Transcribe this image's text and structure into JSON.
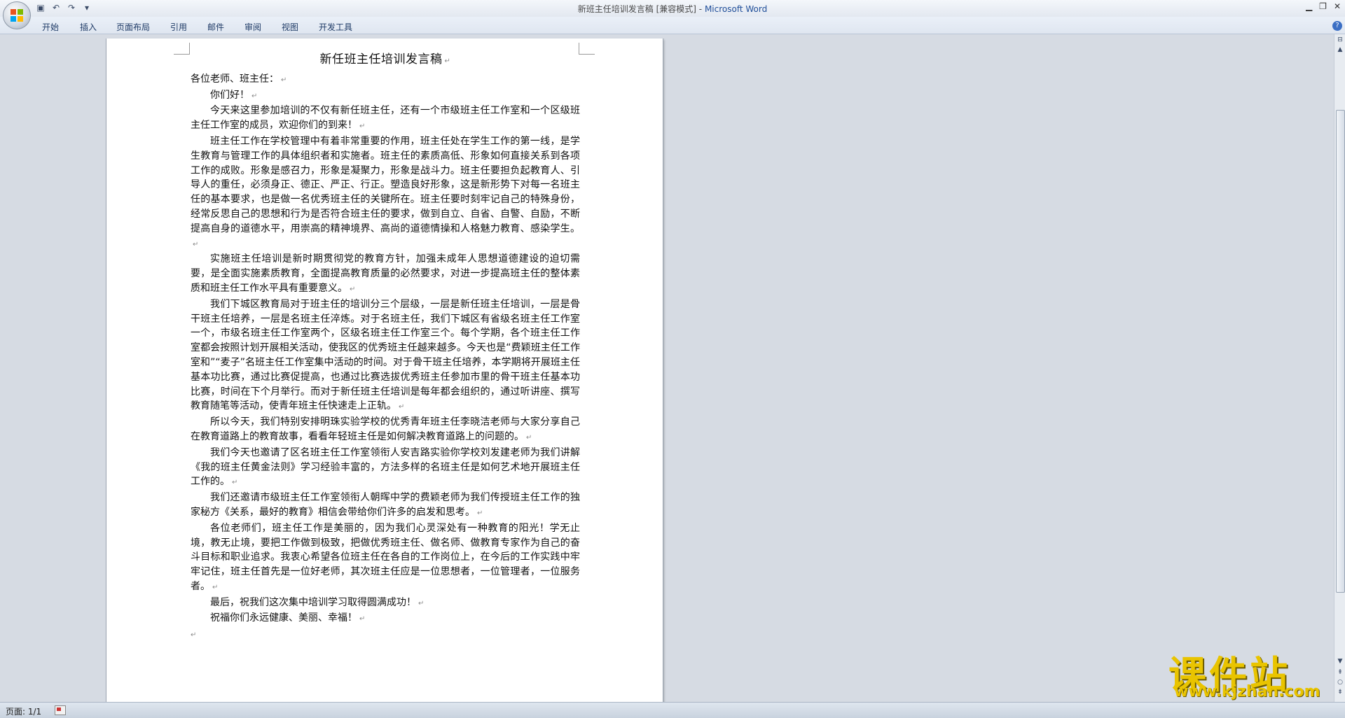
{
  "titlebar": {
    "doc_title": "新班主任培训发言稿 [兼容模式]",
    "separator": " - ",
    "app_name": "Microsoft Word"
  },
  "qat": {
    "save_icon": "save-icon",
    "undo_icon": "undo-icon",
    "redo_icon": "redo-icon",
    "more_icon": "dropdown-icon"
  },
  "tabs": [
    "开始",
    "插入",
    "页面布局",
    "引用",
    "邮件",
    "审阅",
    "视图",
    "开发工具"
  ],
  "document": {
    "title": "新任班主任培训发言稿",
    "paragraphs": [
      "各位老师、班主任：",
      "你们好！",
      "今天来这里参加培训的不仅有新任班主任，还有一个市级班主任工作室和一个区级班主任工作室的成员，欢迎你们的到来！",
      "班主任工作在学校管理中有着非常重要的作用，班主任处在学生工作的第一线，是学生教育与管理工作的具体组织者和实施者。班主任的素质高低、形象如何直接关系到各项工作的成败。形象是感召力，形象是凝聚力，形象是战斗力。班主任要担负起教育人、引导人的重任，必须身正、德正、严正、行正。塑造良好形象，这是新形势下对每一名班主任的基本要求，也是做一名优秀班主任的关键所在。班主任要时刻牢记自己的特殊身份，经常反思自己的思想和行为是否符合班主任的要求，做到自立、自省、自警、自励，不断提高自身的道德水平，用崇高的精神境界、高尚的道德情操和人格魅力教育、感染学生。",
      "实施班主任培训是新时期贯彻党的教育方针，加强未成年人思想道德建设的迫切需要，是全面实施素质教育，全面提高教育质量的必然要求，对进一步提高班主任的整体素质和班主任工作水平具有重要意义。",
      "我们下城区教育局对于班主任的培训分三个层级，一层是新任班主任培训，一层是骨干班主任培养，一层是名班主任淬炼。对于名班主任，我们下城区有省级名班主任工作室一个，市级名班主任工作室两个，区级名班主任工作室三个。每个学期，各个班主任工作室都会按照计划开展相关活动，使我区的优秀班主任越来越多。今天也是“费颖班主任工作室和”“麦子”名班主任工作室集中活动的时间。对于骨干班主任培养，本学期将开展班主任基本功比赛，通过比赛促提高，也通过比赛选拔优秀班主任参加市里的骨干班主任基本功比赛，时间在下个月举行。而对于新任班主任培训是每年都会组织的，通过听讲座、撰写教育随笔等活动，使青年班主任快速走上正轨。",
      "所以今天，我们特别安排明珠实验学校的优秀青年班主任李晓洁老师与大家分享自己在教育道路上的教育故事，看看年轻班主任是如何解决教育道路上的问题的。",
      "我们今天也邀请了区名班主任工作室领衔人安吉路实验你学校刘发建老师为我们讲解《我的班主任黄金法则》学习经验丰富的，方法多样的名班主任是如何艺术地开展班主任工作的。",
      "我们还邀请市级班主任工作室领衔人朝晖中学的费颖老师为我们传授班主任工作的独家秘方《关系，最好的教育》相信会带给你们许多的启发和思考。",
      "各位老师们，班主任工作是美丽的，因为我们心灵深处有一种教育的阳光！学无止境，教无止境，要把工作做到极致，把做优秀班主任、做名师、做教育专家作为自己的奋斗目标和职业追求。我衷心希望各位班主任在各自的工作岗位上，在今后的工作实践中牢牢记住，班主任首先是一位好老师，其次班主任应是一位思想者，一位管理者，一位服务者。",
      "最后，祝我们这次集中培训学习取得圆满成功！",
      "祝福你们永远健康、美丽、幸福！"
    ],
    "paragraph_mark": "↵"
  },
  "statusbar": {
    "page_info": "页面: 1/1",
    "proofing_icon": "proofing-icon"
  },
  "watermark": {
    "cn": "课件站",
    "url": "www.kjzhan.com"
  },
  "colors": {
    "app_name": "#1f4e99",
    "watermark": "#e9c400",
    "background": "#d6dbe3"
  }
}
